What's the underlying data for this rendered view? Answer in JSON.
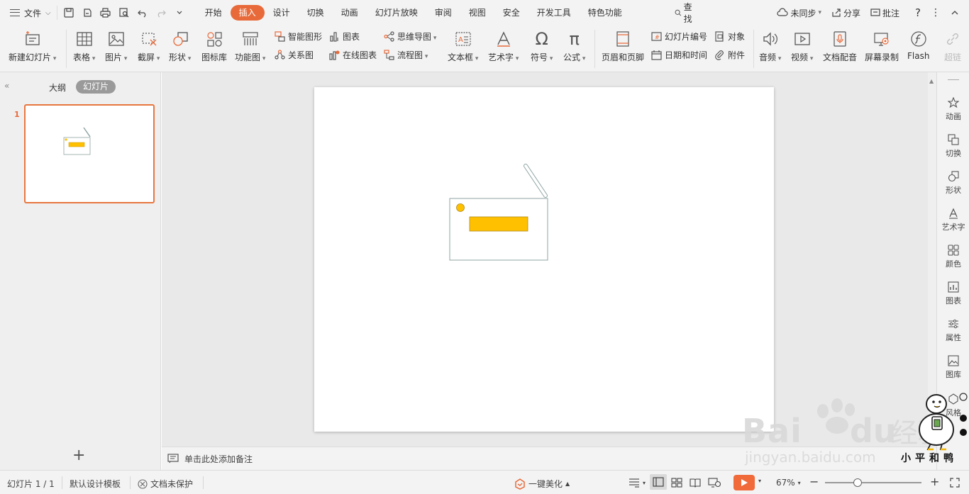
{
  "menubar": {
    "file_label": "文件",
    "tabs": [
      {
        "label": "开始",
        "active": false
      },
      {
        "label": "插入",
        "active": true
      },
      {
        "label": "设计",
        "active": false
      },
      {
        "label": "切换",
        "active": false
      },
      {
        "label": "动画",
        "active": false
      },
      {
        "label": "幻灯片放映",
        "active": false
      },
      {
        "label": "审阅",
        "active": false
      },
      {
        "label": "视图",
        "active": false
      },
      {
        "label": "安全",
        "active": false
      },
      {
        "label": "开发工具",
        "active": false
      },
      {
        "label": "特色功能",
        "active": false
      }
    ],
    "search_label": "查找",
    "sync_label": "未同步",
    "share_label": "分享",
    "comment_label": "批注",
    "help_label": "?",
    "more_label": "⋮"
  },
  "ribbon": {
    "new_slide": "新建幻灯片",
    "table": "表格",
    "picture": "图片",
    "screenshot": "截屏",
    "shape": "形状",
    "icon_lib": "图标库",
    "function_chart": "功能图",
    "smart_shape": "智能图形",
    "relation_chart": "关系图",
    "chart": "图表",
    "online_chart": "在线图表",
    "mind_map": "思维导图",
    "flowchart": "流程图",
    "textbox": "文本框",
    "wordart": "艺术字",
    "symbol": "符号",
    "formula": "公式",
    "header_footer": "页眉和页脚",
    "slide_number": "幻灯片编号",
    "date_time": "日期和时间",
    "object": "对象",
    "attachment": "附件",
    "audio": "音频",
    "video": "视频",
    "doc_voice": "文档配音",
    "screen_record": "屏幕录制",
    "flash": "Flash",
    "hyperlink": "超链"
  },
  "leftpanel": {
    "outline_tab": "大纲",
    "slides_tab": "幻灯片",
    "slide_number": "1",
    "add_slide": "+"
  },
  "notes": {
    "placeholder": "单击此处添加备注"
  },
  "rightpanel": {
    "items": [
      "动画",
      "切换",
      "形状",
      "艺术字",
      "颜色",
      "图表",
      "属性",
      "图库",
      "风格"
    ]
  },
  "statusbar": {
    "slide_info": "幻灯片 1 / 1",
    "template": "默认设计模板",
    "protection": "文档未保护",
    "beautify": "一键美化",
    "zoom": "67%"
  },
  "watermark": {
    "brand": "Baidu经验",
    "url": "jingyan.baidu.com",
    "signature": "小平和鸭"
  },
  "colors": {
    "accent": "#e86a3a",
    "shape_fill": "#ffc000",
    "shape_stroke": "#8fa3a3"
  }
}
